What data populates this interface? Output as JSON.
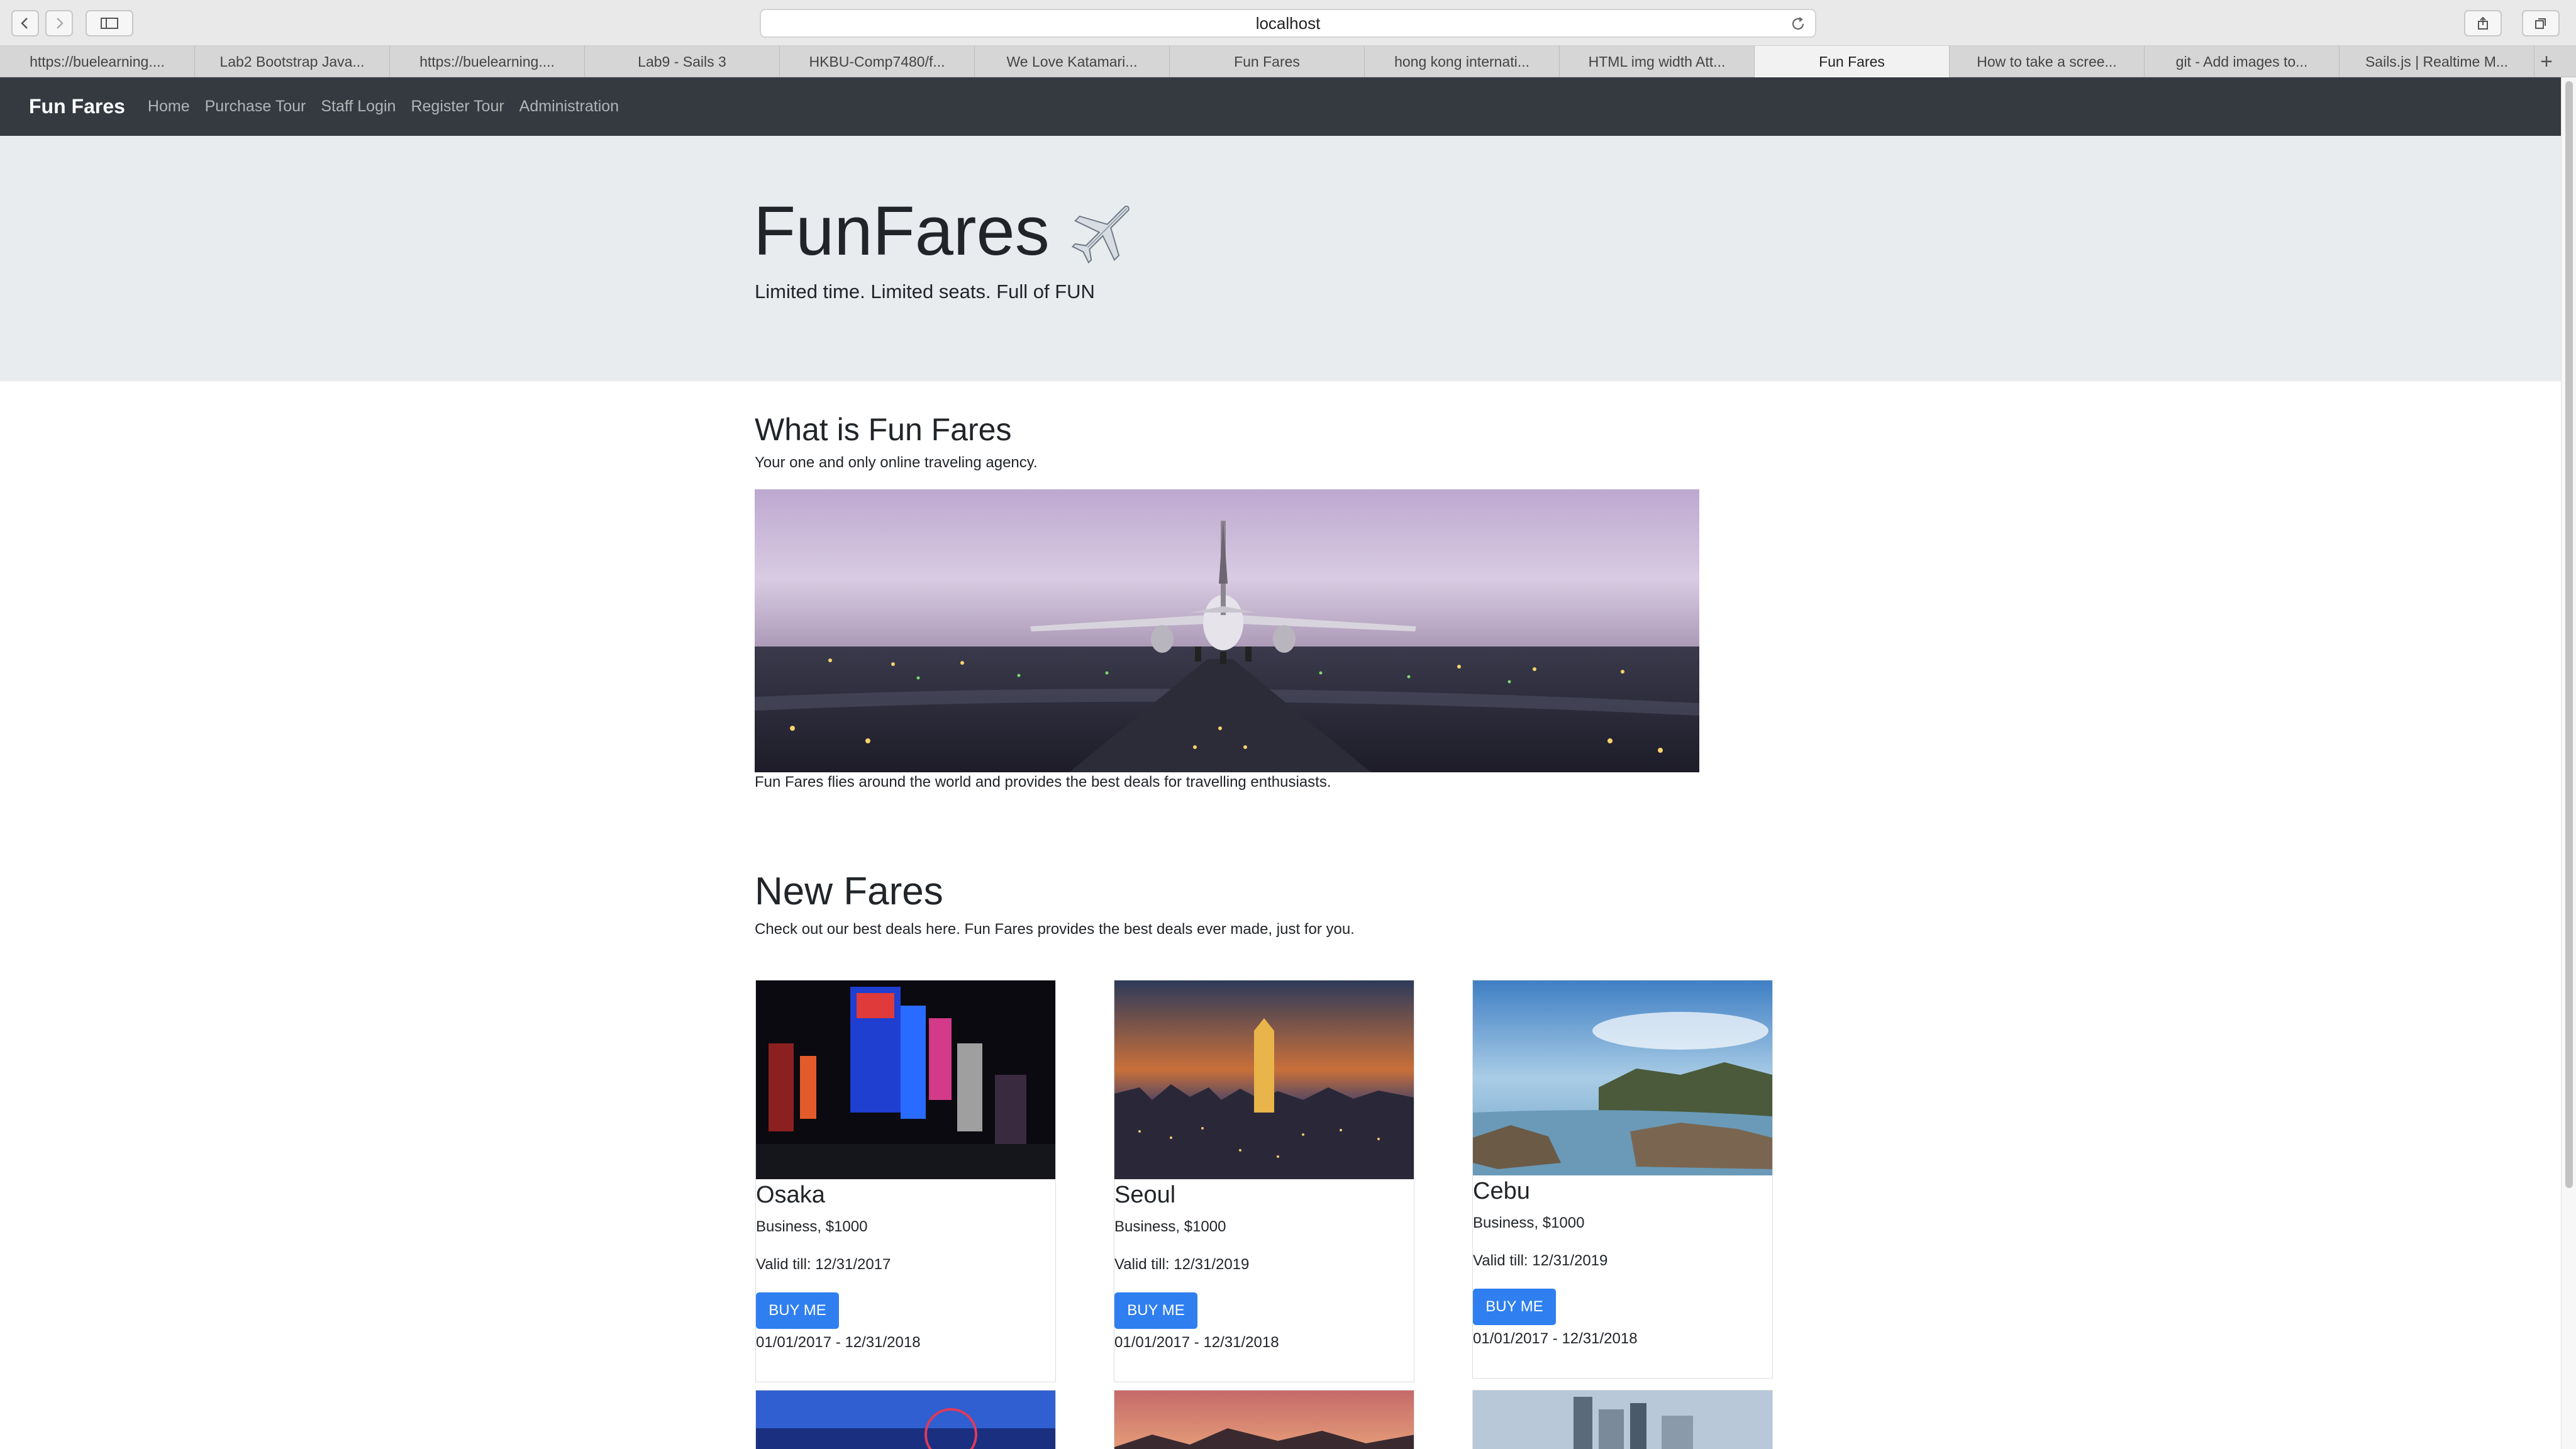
{
  "browser": {
    "url": "localhost",
    "tabs": [
      {
        "label": "https://buelearning....",
        "active": false
      },
      {
        "label": "Lab2 Bootstrap Java...",
        "active": false
      },
      {
        "label": "https://buelearning....",
        "active": false
      },
      {
        "label": "Lab9 - Sails 3",
        "active": false
      },
      {
        "label": "HKBU-Comp7480/f...",
        "active": false
      },
      {
        "label": "We Love Katamari...",
        "active": false
      },
      {
        "label": "Fun Fares",
        "active": false
      },
      {
        "label": "hong kong internati...",
        "active": false
      },
      {
        "label": "HTML img width Att...",
        "active": false
      },
      {
        "label": "Fun Fares",
        "active": true
      },
      {
        "label": "How to take a scree...",
        "active": false
      },
      {
        "label": "git - Add images to...",
        "active": false
      },
      {
        "label": "Sails.js | Realtime M...",
        "active": false
      }
    ]
  },
  "navbar": {
    "brand": "Fun Fares",
    "links": [
      "Home",
      "Purchase Tour",
      "Staff Login",
      "Register Tour",
      "Administration"
    ]
  },
  "jumbotron": {
    "title": "FunFares",
    "lead": "Limited time. Limited seats. Full of FUN"
  },
  "about": {
    "heading": "What is Fun Fares",
    "text": "Your one and only online traveling agency.",
    "caption": "Fun Fares flies around the world and provides the best deals for travelling enthusiasts."
  },
  "fares": {
    "heading": "New Fares",
    "text": "Check out our best deals here. Fun Fares provides the best deals ever made, just for you.",
    "cards": [
      {
        "title": "Osaka",
        "class_price": "Business, $1000",
        "valid": "Valid till: 12/31/2017",
        "button": "BUY ME",
        "range": "01/01/2017 - 12/31/2018"
      },
      {
        "title": "Seoul",
        "class_price": "Business, $1000",
        "valid": "Valid till: 12/31/2019",
        "button": "BUY ME",
        "range": "01/01/2017 - 12/31/2018"
      },
      {
        "title": "Cebu",
        "class_price": "Business, $1000",
        "valid": "Valid till: 12/31/2019",
        "button": "BUY ME",
        "range": "01/01/2017 - 12/31/2018"
      }
    ]
  },
  "colors": {
    "navbar_bg": "#343a40",
    "jumbotron_bg": "#e9ecef",
    "button_primary": "#2f7ff0"
  }
}
